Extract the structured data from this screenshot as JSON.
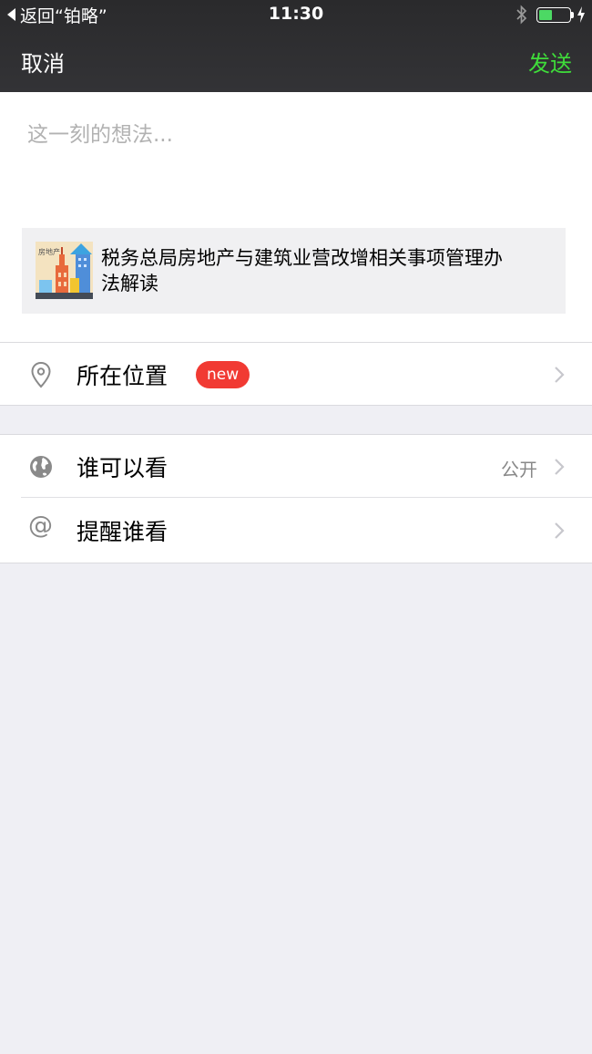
{
  "status_bar": {
    "back_app": "返回“铂略”",
    "time": "11:30",
    "battery_level": 0.45,
    "bluetooth_icon": "bluetooth-icon",
    "charging_icon": "charging-bolt-icon"
  },
  "nav": {
    "cancel_label": "取消",
    "send_label": "发送",
    "send_color": "#3fdc3a"
  },
  "compose": {
    "placeholder": "这一刻的想法..."
  },
  "share_card": {
    "title": "税务总局房地产与建筑业营改增相关事项管理办法解读",
    "thumbnail_text": "房地产"
  },
  "location": {
    "label": "所在位置",
    "badge": "new",
    "icon": "location-pin-icon"
  },
  "visibility": {
    "label": "谁可以看",
    "value": "公开",
    "icon": "globe-icon"
  },
  "mention": {
    "label": "提醒谁看",
    "icon": "at-icon",
    "icon_text": "@"
  },
  "colors": {
    "top_bar": "#2f2f31",
    "background": "#efeff4",
    "badge": "#f13a33"
  }
}
